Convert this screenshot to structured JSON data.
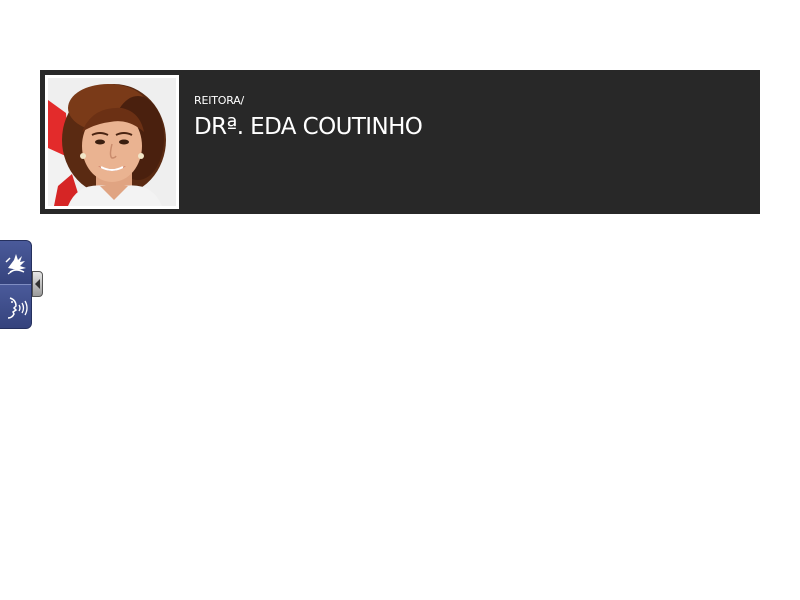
{
  "profile": {
    "role": "REITORA/",
    "name": "DRª. EDA COUTINHO"
  },
  "accessibility_widget": {
    "buttons": [
      {
        "icon": "sign-language-icon"
      },
      {
        "icon": "audio-speech-icon"
      }
    ],
    "toggle_icon": "chevron-left-icon"
  },
  "colors": {
    "banner_background": "#282828",
    "banner_text": "#ffffff",
    "widget_accent": "#3b4a86"
  }
}
